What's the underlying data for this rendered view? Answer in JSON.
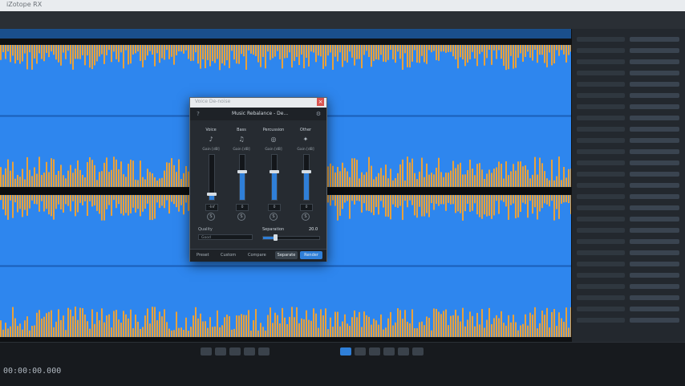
{
  "app": {
    "title": "iZotope RX"
  },
  "colors": {
    "waveform_blue": "#2e86ee",
    "waveform_orange": "#e9a13a",
    "accent": "#2f7fd8"
  },
  "dialog": {
    "title": "Voice De-noise",
    "header_name": "Music Rebalance - De...",
    "columns": [
      {
        "label": "Voice",
        "sub": "Gain [dB]",
        "icon": "mic-icon",
        "level": 0.12,
        "value": "-Inf"
      },
      {
        "label": "Bass",
        "sub": "Gain [dB]",
        "icon": "bass-icon",
        "level": 0.62,
        "value": "0"
      },
      {
        "label": "Percussion",
        "sub": "Gain [dB]",
        "icon": "drum-icon",
        "level": 0.62,
        "value": "0"
      },
      {
        "label": "Other",
        "sub": "Gain [dB]",
        "icon": "other-icon",
        "level": 0.62,
        "value": "0"
      }
    ],
    "quality_label": "Quality",
    "quality_value": "Good",
    "separation_label": "Separation",
    "separation_value": "20.0",
    "separation_level": 0.22,
    "footer": {
      "presets": "Preset",
      "preset_value": "Custom",
      "compare": "Compare",
      "learn": "Separate",
      "render": "Render"
    }
  },
  "transport": {
    "time": "00:00:00.000"
  }
}
